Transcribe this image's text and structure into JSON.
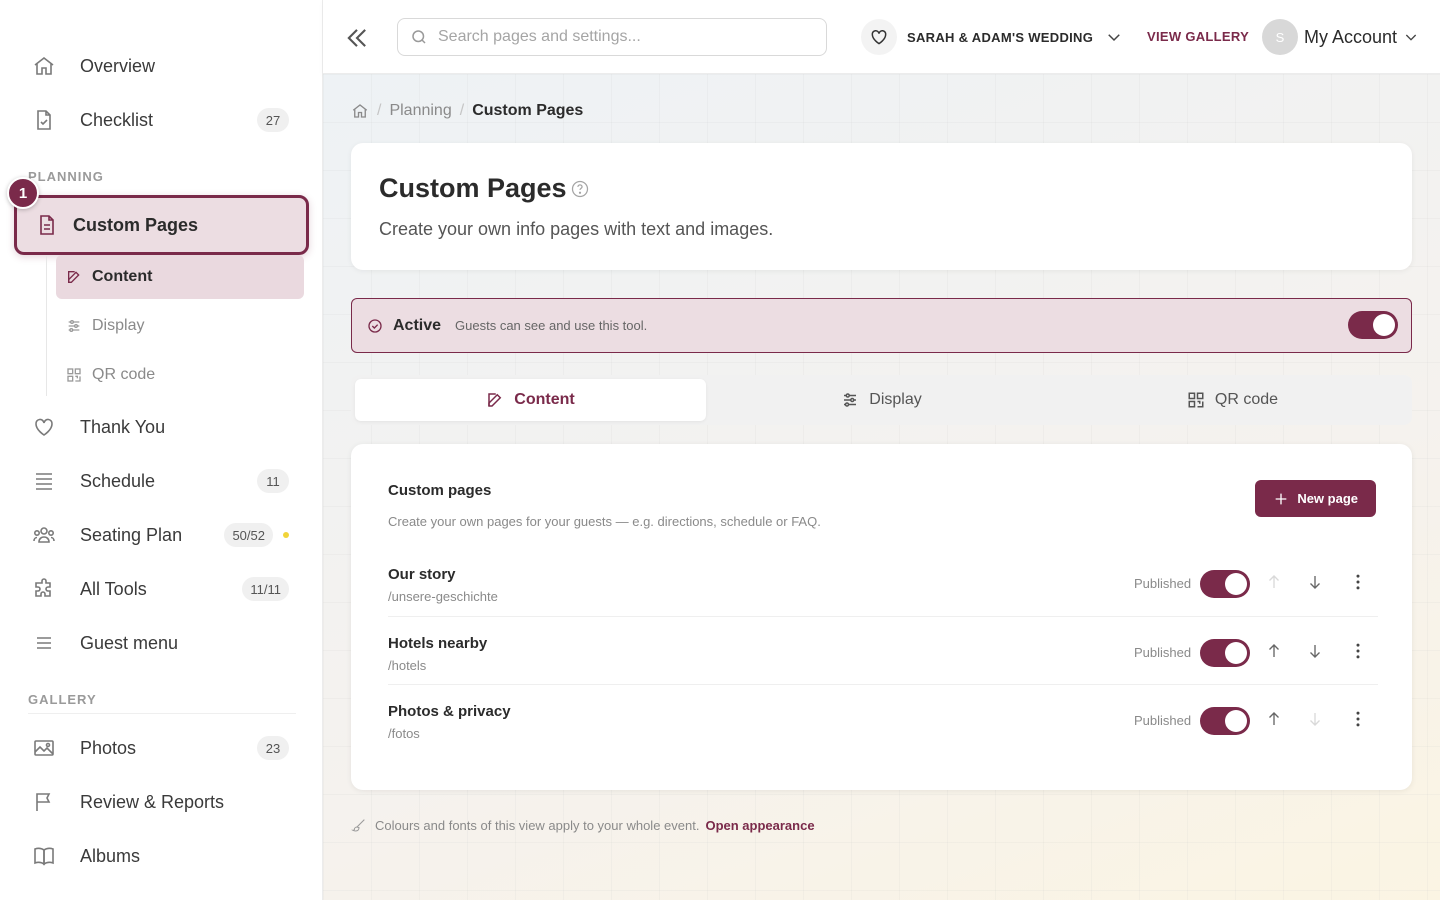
{
  "sidebar": {
    "items": [
      {
        "label": "Overview",
        "icon": "home-icon"
      },
      {
        "label": "Checklist",
        "icon": "checklist-icon",
        "count": "27"
      },
      {
        "label": "Custom Pages",
        "icon": "document-icon",
        "step": "1"
      },
      {
        "label": "Thank You",
        "icon": "heart-icon"
      },
      {
        "label": "Schedule",
        "icon": "list-icon",
        "count": "11"
      },
      {
        "label": "Seating Plan",
        "icon": "people-icon",
        "count": "50/52"
      },
      {
        "label": "All Tools",
        "icon": "puzzle-icon",
        "count": "11/11"
      },
      {
        "label": "Guest menu",
        "icon": "menu-icon"
      },
      {
        "label": "Photos",
        "icon": "image-icon",
        "count": "23"
      },
      {
        "label": "Review & Reports",
        "icon": "flag-icon"
      },
      {
        "label": "Albums",
        "icon": "book-icon"
      }
    ],
    "sections": {
      "planning": "PLANNING",
      "gallery": "GALLERY"
    },
    "sub_items": [
      {
        "label": "Content",
        "icon": "edit-icon"
      },
      {
        "label": "Display",
        "icon": "sliders-icon"
      },
      {
        "label": "QR code",
        "icon": "qr-icon"
      }
    ],
    "colors": {
      "accent": "#7a2a4a",
      "status_dot": "#f1d43a"
    }
  },
  "topbar": {
    "search_placeholder": "Search pages and settings...",
    "event_name": "SARAH & ADAM'S WEDDING",
    "view_gallery": "VIEW GALLERY",
    "avatar_initial": "S",
    "account_label": "My Account"
  },
  "breadcrumb": {
    "parent": "Planning",
    "current": "Custom Pages"
  },
  "header": {
    "title": "Custom Pages",
    "description": "Create your own info pages with text and images."
  },
  "status": {
    "state": "Active",
    "hint": "Guests can see and use this tool.",
    "enabled": true
  },
  "tabs": [
    {
      "label": "Content",
      "icon": "edit-icon",
      "active": true
    },
    {
      "label": "Display",
      "icon": "sliders-icon",
      "active": false
    },
    {
      "label": "QR code",
      "icon": "qr-icon",
      "active": false
    }
  ],
  "pages_card": {
    "title": "Custom pages",
    "subtitle": "Create your own pages for your guests — e.g. directions, schedule or FAQ.",
    "new_button": "New page",
    "rows": [
      {
        "name": "Our story",
        "slug": "/unsere-geschichte",
        "status": "Published",
        "published": true,
        "can_move_up": false,
        "can_move_down": true
      },
      {
        "name": "Hotels nearby",
        "slug": "/hotels",
        "status": "Published",
        "published": true,
        "can_move_up": true,
        "can_move_down": true
      },
      {
        "name": "Photos & privacy",
        "slug": "/fotos",
        "status": "Published",
        "published": true,
        "can_move_up": true,
        "can_move_down": false
      }
    ]
  },
  "footer": {
    "note": "Colours and fonts of this view apply to your whole event.",
    "link": "Open appearance"
  }
}
